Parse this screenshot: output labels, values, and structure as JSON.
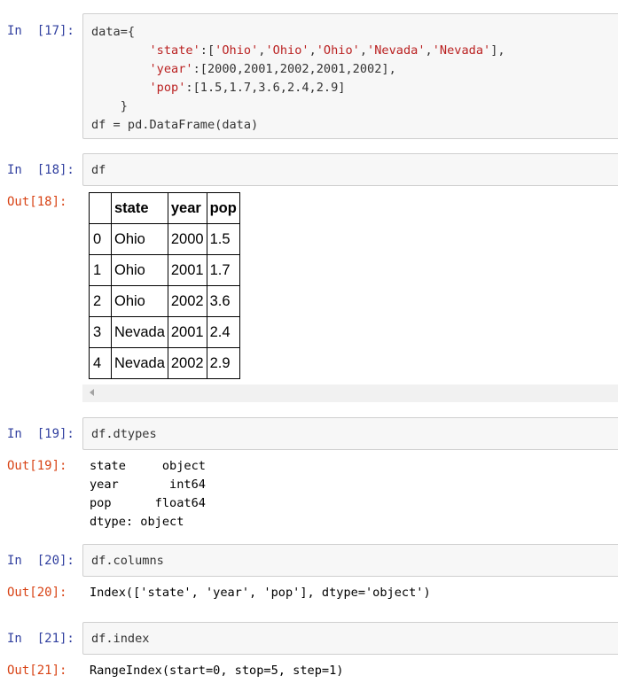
{
  "cells": [
    {
      "in_prompt": "In  [17]:",
      "code_lines": [
        "data={",
        "        'state':['Ohio','Ohio','Ohio','Nevada','Nevada'],",
        "        'year':[2000,2001,2002,2001,2002],",
        "        'pop':[1.5,1.7,3.6,2.4,2.9]",
        "    }",
        "df = pd.DataFrame(data)"
      ]
    },
    {
      "in_prompt": "In  [18]:",
      "code": "df",
      "out_prompt": "Out[18]:",
      "table": {
        "columns": [
          "",
          "state",
          "year",
          "pop"
        ],
        "rows": [
          [
            "0",
            "Ohio",
            "2000",
            "1.5"
          ],
          [
            "1",
            "Ohio",
            "2001",
            "1.7"
          ],
          [
            "2",
            "Ohio",
            "2002",
            "3.6"
          ],
          [
            "3",
            "Nevada",
            "2001",
            "2.4"
          ],
          [
            "4",
            "Nevada",
            "2002",
            "2.9"
          ]
        ]
      }
    },
    {
      "in_prompt": "In  [19]:",
      "code": "df.dtypes",
      "out_prompt": "Out[19]:",
      "output": "state     object\nyear       int64\npop      float64\ndtype: object"
    },
    {
      "in_prompt": "In  [20]:",
      "code": "df.columns",
      "out_prompt": "Out[20]:",
      "output": "Index(['state', 'year', 'pop'], dtype='object')"
    },
    {
      "in_prompt": "In  [21]:",
      "code": "df.index",
      "out_prompt": "Out[21]:",
      "output": "RangeIndex(start=0, stop=5, step=1)"
    }
  ],
  "colors": {
    "in_prompt": "#303f9f",
    "out_prompt": "#d84315",
    "string": "#ba2121",
    "cell_bg": "#f7f7f7"
  }
}
